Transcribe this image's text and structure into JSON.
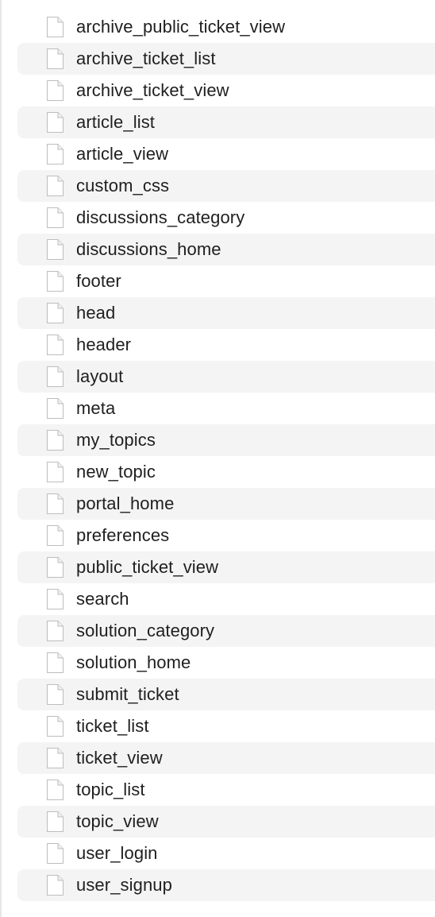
{
  "file_browser": {
    "icon": "document-icon",
    "files": [
      "archive_public_ticket_view",
      "archive_ticket_list",
      "archive_ticket_view",
      "article_list",
      "article_view",
      "custom_css",
      "discussions_category",
      "discussions_home",
      "footer",
      "head",
      "header",
      "layout",
      "meta",
      "my_topics",
      "new_topic",
      "portal_home",
      "preferences",
      "public_ticket_view",
      "search",
      "solution_category",
      "solution_home",
      "submit_ticket",
      "ticket_list",
      "ticket_view",
      "topic_list",
      "topic_view",
      "user_login",
      "user_signup"
    ]
  }
}
